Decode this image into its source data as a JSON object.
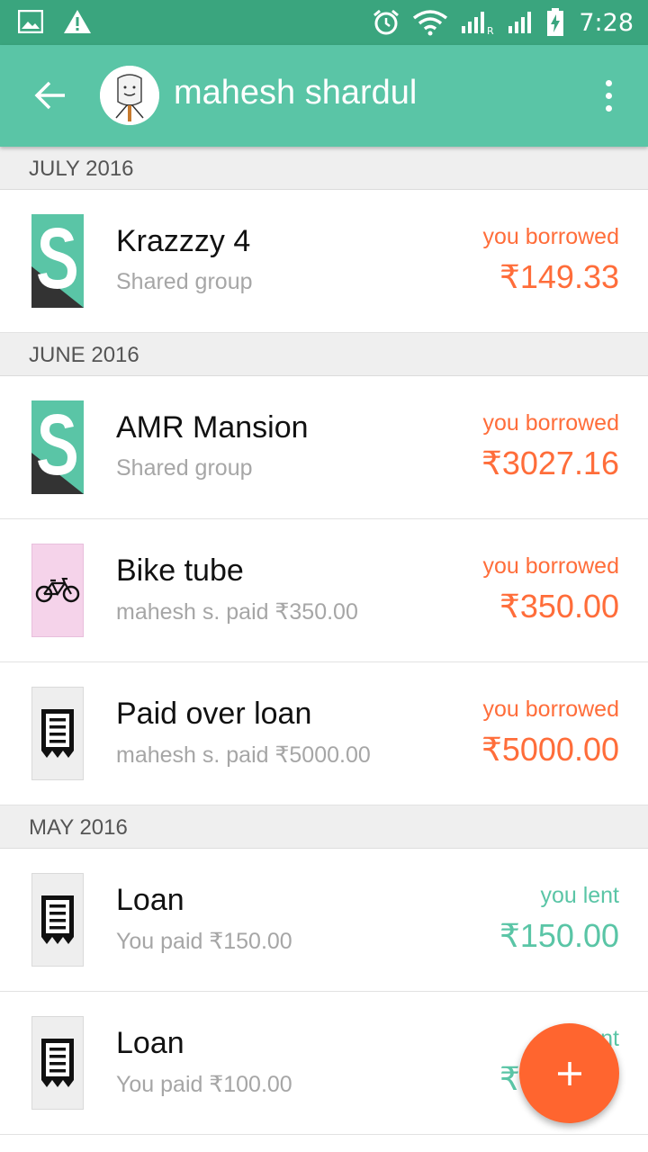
{
  "status_bar": {
    "time": "7:28",
    "colors": {
      "background": "#3aa57e"
    },
    "icons": [
      "image-notification-icon",
      "warning-icon",
      "alarm-icon",
      "wifi-icon",
      "signal-roaming-icon",
      "signal-icon",
      "battery-charging-icon"
    ]
  },
  "app_bar": {
    "title": "mahesh shardul",
    "colors": {
      "background": "#5ac5a6"
    }
  },
  "colors": {
    "borrowed": "#ff6d3a",
    "lent": "#5ac5a6",
    "fab": "#ff652f"
  },
  "sections": [
    {
      "header": "JULY 2016",
      "items": [
        {
          "title": "Krazzzy 4",
          "subtitle": "Shared group",
          "status": "you borrowed",
          "amount": "₹149.33",
          "icon": "splitwise-group-icon"
        }
      ]
    },
    {
      "header": "JUNE 2016",
      "items": [
        {
          "title": "AMR Mansion",
          "subtitle": "Shared group",
          "status": "you borrowed",
          "amount": "₹3027.16",
          "icon": "splitwise-group-icon"
        },
        {
          "title": "Bike tube",
          "subtitle": "mahesh s. paid ₹350.00",
          "status": "you borrowed",
          "amount": "₹350.00",
          "icon": "bicycle-icon"
        },
        {
          "title": "Paid over loan",
          "subtitle": "mahesh s. paid ₹5000.00",
          "status": "you borrowed",
          "amount": "₹5000.00",
          "icon": "receipt-icon"
        }
      ]
    },
    {
      "header": "MAY 2016",
      "items": [
        {
          "title": "Loan",
          "subtitle": "You paid ₹150.00",
          "status": "you lent",
          "amount": "₹150.00",
          "icon": "receipt-icon"
        },
        {
          "title": "Loan",
          "subtitle": "You paid ₹100.00",
          "status": "you lent",
          "amount": "₹100.00",
          "icon": "receipt-icon"
        }
      ]
    }
  ],
  "fab": {
    "icon": "plus-icon"
  }
}
